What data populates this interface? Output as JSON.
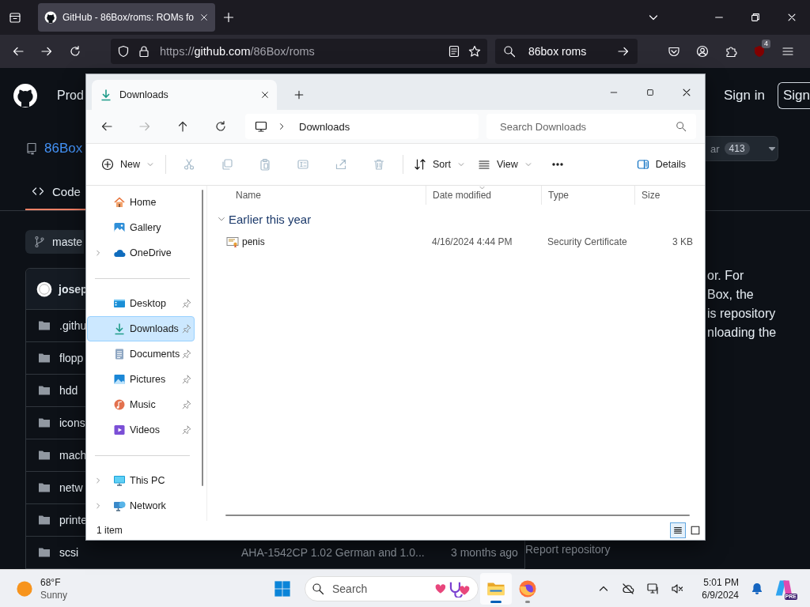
{
  "browser": {
    "tabs": [
      {
        "title": "GitHub - 86Box/roms: ROMs fo",
        "selected": true
      }
    ],
    "address": {
      "scheme": "https://",
      "host": "github.com",
      "path": "/86Box/roms"
    },
    "search": {
      "value": "86box roms"
    },
    "extension_badge": "4"
  },
  "github": {
    "nav_item": "Prod",
    "sign_in": "Sign in",
    "sign_up": "Sign",
    "repo_name": "86Box",
    "star_label": "ar",
    "star_count": "413",
    "tabs": [
      {
        "label": "Code",
        "selected": true
      }
    ],
    "branch": "maste",
    "commit_author": "josep",
    "files": [
      {
        "name": ".githu"
      },
      {
        "name": "flopp"
      },
      {
        "name": "hdd"
      },
      {
        "name": "icons"
      },
      {
        "name": "mach"
      },
      {
        "name": "netw"
      },
      {
        "name": "printe"
      },
      {
        "name": "scsi",
        "message": "AHA-1542CP 1.02 German and 1.0...",
        "time": "3 months ago"
      }
    ],
    "about_lines": [
      "or. For",
      "Box, the",
      "is repository",
      "nloading the"
    ],
    "report_link": "Report repository"
  },
  "explorer": {
    "tabs": [
      {
        "label": "Downloads",
        "selected": true
      }
    ],
    "nav_buttons": [
      {
        "kind": "back",
        "disabled": false
      },
      {
        "kind": "forward",
        "disabled": true
      },
      {
        "kind": "up",
        "disabled": false
      },
      {
        "kind": "refresh",
        "disabled": false
      }
    ],
    "breadcrumb": [
      "Downloads"
    ],
    "search": {
      "placeholder": "Search Downloads"
    },
    "commands": [
      {
        "kind": "new",
        "label": "New",
        "disabled": false,
        "menu": true
      },
      {
        "kind": "cut",
        "disabled": true
      },
      {
        "kind": "copy",
        "disabled": true
      },
      {
        "kind": "paste",
        "disabled": true
      },
      {
        "kind": "rename",
        "disabled": true
      },
      {
        "kind": "share",
        "disabled": true
      },
      {
        "kind": "delete",
        "disabled": true
      },
      {
        "kind": "sort",
        "label": "Sort",
        "disabled": false,
        "menu": true
      },
      {
        "kind": "view",
        "label": "View",
        "disabled": false,
        "menu": true
      },
      {
        "kind": "more",
        "disabled": false
      }
    ],
    "details_button": {
      "label": "Details"
    },
    "sidebar": {
      "groups": [
        {
          "items": [
            {
              "label": "Home",
              "kind": "home",
              "selected": false,
              "pinned": false,
              "expandable": false
            },
            {
              "label": "Gallery",
              "kind": "gallery",
              "selected": false,
              "pinned": false,
              "expandable": false
            },
            {
              "label": "OneDrive",
              "kind": "cloud",
              "selected": false,
              "pinned": false,
              "expandable": true
            }
          ]
        },
        {
          "items": [
            {
              "label": "Desktop",
              "kind": "desktop",
              "selected": false,
              "pinned": true,
              "expandable": false
            },
            {
              "label": "Downloads",
              "kind": "download",
              "selected": true,
              "pinned": true,
              "expandable": false
            },
            {
              "label": "Documents",
              "kind": "document",
              "selected": false,
              "pinned": true,
              "expandable": false
            },
            {
              "label": "Pictures",
              "kind": "image",
              "selected": false,
              "pinned": true,
              "expandable": false
            },
            {
              "label": "Music",
              "kind": "music",
              "selected": false,
              "pinned": true,
              "expandable": false
            },
            {
              "label": "Videos",
              "kind": "video",
              "selected": false,
              "pinned": true,
              "expandable": false
            }
          ]
        },
        {
          "items": [
            {
              "label": "This PC",
              "kind": "monitor",
              "selected": false,
              "pinned": false,
              "expandable": true
            },
            {
              "label": "Network",
              "kind": "network",
              "selected": false,
              "pinned": false,
              "expandable": true
            }
          ]
        }
      ]
    },
    "columns": [
      {
        "label": "Name",
        "sorted": false
      },
      {
        "label": "Date modified",
        "sorted": true
      },
      {
        "label": "Type",
        "sorted": false
      },
      {
        "label": "Size",
        "sorted": false
      }
    ],
    "groups": [
      {
        "label": "Earlier this year",
        "expanded": true,
        "files": [
          {
            "name": "penis",
            "modified": "4/16/2024 4:44 PM",
            "type": "Security Certificate",
            "size": "3 KB"
          }
        ]
      }
    ],
    "status": "1 item",
    "view_modes": [
      {
        "kind": "details",
        "selected": true
      },
      {
        "kind": "tiles",
        "selected": false
      }
    ]
  },
  "taskbar": {
    "weather": {
      "temperature": "68°F",
      "condition": "Sunny"
    },
    "search": {
      "placeholder": "Search"
    },
    "apps": [
      {
        "kind": "explorer",
        "active": true
      },
      {
        "kind": "firefox",
        "active": false
      }
    ],
    "clock": {
      "time": "5:01 PM",
      "date": "6/9/2024"
    },
    "copilot_badge": "PRE"
  }
}
